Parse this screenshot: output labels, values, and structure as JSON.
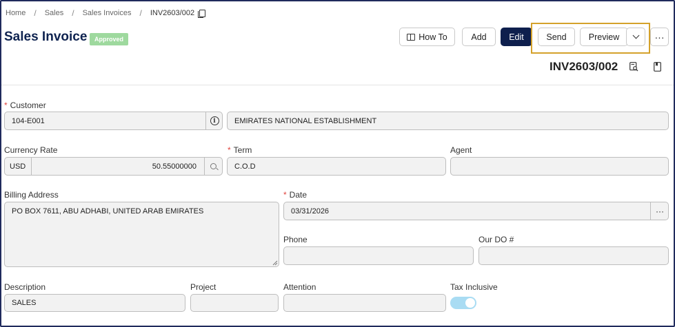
{
  "breadcrumb": {
    "items": [
      "Home",
      "Sales",
      "Sales Invoices",
      "INV2603/002"
    ]
  },
  "header": {
    "title": "Sales Invoice",
    "status": "Approved",
    "status_color": "#9ed99e",
    "doc_number": "INV2603/002"
  },
  "toolbar": {
    "how_to_label": "How To",
    "add_label": "Add",
    "edit_label": "Edit",
    "send_label": "Send",
    "preview_label": "Preview",
    "more_label": "···",
    "edit_color": "#0e1f4d",
    "highlight_color": "#d4a12a"
  },
  "form": {
    "customer": {
      "label": "Customer",
      "code": "104-E001",
      "name": "EMIRATES NATIONAL ESTABLISHMENT"
    },
    "currency_rate": {
      "label": "Currency Rate",
      "currency": "USD",
      "rate": "50.55000000"
    },
    "term": {
      "label": "Term",
      "value": "C.O.D"
    },
    "agent": {
      "label": "Agent",
      "value": ""
    },
    "billing_address": {
      "label": "Billing Address",
      "value": "PO BOX 7611, ABU ADHABI, UNITED ARAB EMIRATES"
    },
    "date": {
      "label": "Date",
      "value": "03/31/2026",
      "more": "···"
    },
    "phone": {
      "label": "Phone",
      "value": ""
    },
    "our_do": {
      "label": "Our DO #",
      "value": ""
    },
    "description": {
      "label": "Description",
      "value": "SALES"
    },
    "project": {
      "label": "Project",
      "value": ""
    },
    "attention": {
      "label": "Attention",
      "value": ""
    },
    "tax_inclusive": {
      "label": "Tax Inclusive",
      "enabled": true
    }
  }
}
